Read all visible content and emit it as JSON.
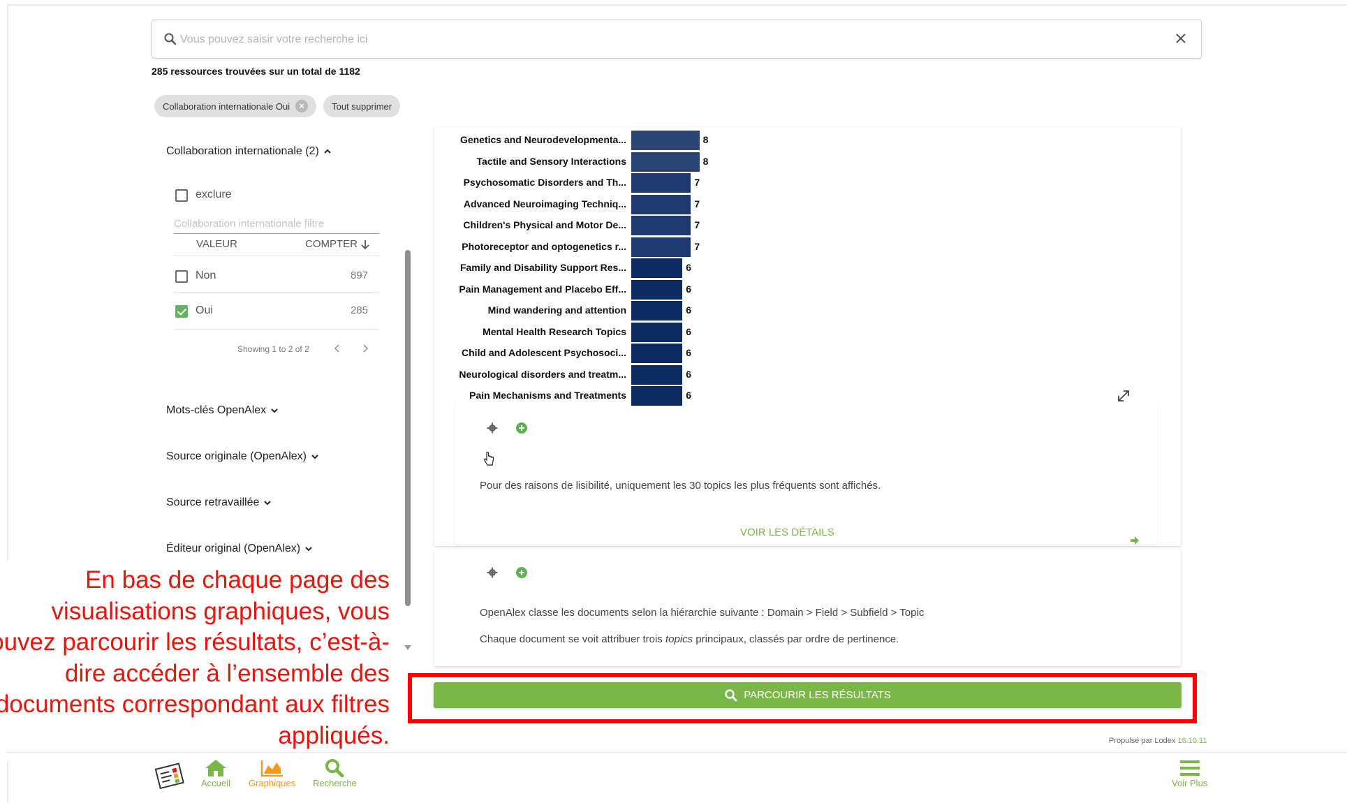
{
  "search": {
    "placeholder": "Vous pouvez saisir votre recherche ici"
  },
  "results_summary": "285 ressources trouvées sur un total de 1182",
  "active_filters": {
    "chip_label": "Collaboration internationale Oui",
    "clear_all_label": "Tout supprimer"
  },
  "sidebar": {
    "facet_intl": {
      "title": "Collaboration internationale (2)",
      "exclude_label": "exclure",
      "filter_placeholder": "Collaboration internationale filtre",
      "col_value": "VALEUR",
      "col_count": "COMPTER",
      "rows": [
        {
          "label": "Non",
          "count": "897",
          "checked": false
        },
        {
          "label": "Oui",
          "count": "285",
          "checked": true
        }
      ],
      "pager": "Showing 1 to 2 of 2"
    },
    "facets": [
      "Mots-clés OpenAlex",
      "Source originale (OpenAlex)",
      "Source retravaillée",
      "Éditeur original (OpenAlex)"
    ]
  },
  "chart_data": {
    "type": "bar",
    "orientation": "horizontal",
    "categories": [
      "Genetics and Neurodevelopmenta...",
      "Tactile and Sensory Interactions",
      "Psychosomatic Disorders and Th...",
      "Advanced Neuroimaging Techniq...",
      "Children's Physical and Motor De...",
      "Photoreceptor and optogenetics r...",
      "Family and Disability Support Res...",
      "Pain Management and Placebo Eff...",
      "Mind wandering and attention",
      "Mental Health Research Topics",
      "Child and Adolescent Psychosoci...",
      "Neurological disorders and treatm...",
      "Pain Mechanisms and Treatments"
    ],
    "values": [
      8,
      8,
      7,
      7,
      7,
      7,
      6,
      6,
      6,
      6,
      6,
      6,
      6
    ],
    "colors": {
      "8": "#2a4473",
      "7": "#1e3a6e",
      "6": "#0d2b5e"
    }
  },
  "chart_card": {
    "note": "Pour des raisons de lisibilité, uniquement les 30 topics les plus fréquents sont affichés.",
    "details_label": "VOIR LES DÉTAILS"
  },
  "info_card": {
    "line1": "OpenAlex classe les documents selon la hiérarchie suivante : Domain > Field > Subfield > Topic",
    "line2_pre": "Chaque document se voit attribuer trois ",
    "line2_em": "topics",
    "line2_post": " principaux, classés par ordre de pertinence."
  },
  "browse_button_label": "PARCOURIR LES RÉSULTATS",
  "annotation": "En bas de chaque page des visualisations graphiques, vous pouvez parcourir les résultats, c’est-à-dire accéder à l’ensemble des documents correspondant aux filtres appliqués.",
  "powered_by": {
    "text": "Propulsé par Lodex ",
    "version": "16.10.11"
  },
  "bottom_nav": {
    "home": "Accueil",
    "charts": "Graphiques",
    "search": "Recherche",
    "more": "Voir Plus"
  },
  "accent_colors": {
    "green": "#7ab648",
    "orange": "#f19a1b",
    "red": "#e8150d"
  }
}
